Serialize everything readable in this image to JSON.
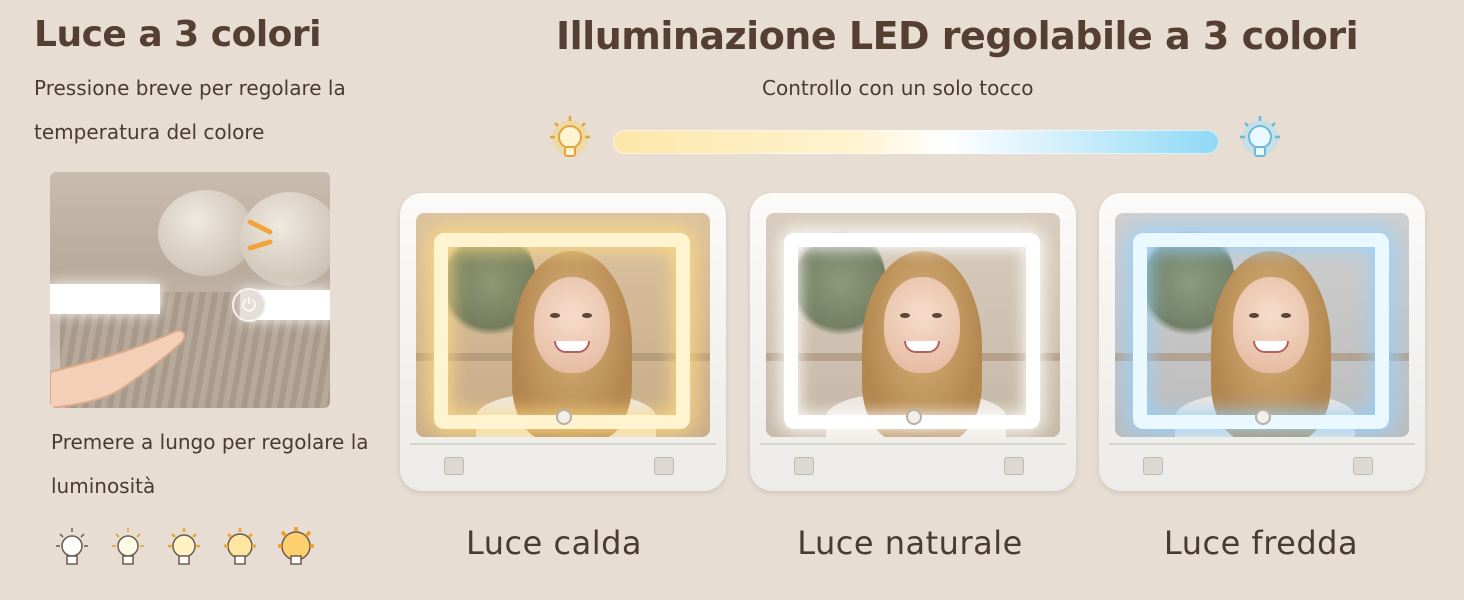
{
  "left": {
    "title": "Luce a 3 colori",
    "short_press": "Pressione breve per regolare la temperatura del colore",
    "long_press": "Premere a lungo per regolare la luminosità",
    "brightness_levels": [
      1,
      2,
      3,
      4,
      5
    ]
  },
  "main": {
    "title": "Illuminazione LED regolabile a 3 colori",
    "subtitle": "Controllo con un solo tocco",
    "modes": [
      {
        "label": "Luce calda",
        "color": "#ffd98a"
      },
      {
        "label": "Luce naturale",
        "color": "#ffffff"
      },
      {
        "label": "Luce fredda",
        "color": "#a8dcff"
      }
    ]
  },
  "colors": {
    "background": "#e7ddd3",
    "text": "#4a3b31",
    "warm": "#f3c24b",
    "cool": "#8fd8f6"
  },
  "icons": {
    "warm_bulb": "bulb-icon",
    "cool_bulb": "bulb-icon",
    "power": "power-icon"
  }
}
